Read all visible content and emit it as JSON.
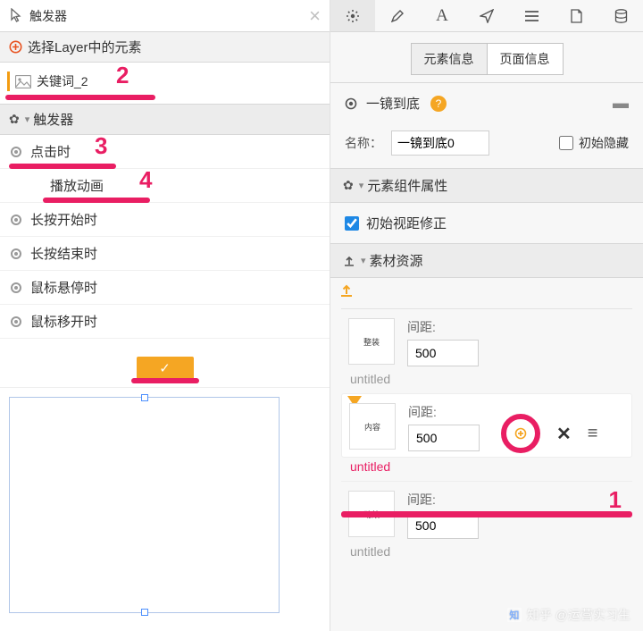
{
  "left": {
    "title": "触发器",
    "select_label": "选择Layer中的元素",
    "keyword_label": "关键词_2",
    "trigger_header": "触发器",
    "triggers": [
      {
        "label": "点击时"
      },
      {
        "label": "播放动画",
        "sub": true
      },
      {
        "label": "长按开始时"
      },
      {
        "label": "长按结束时"
      },
      {
        "label": "鼠标悬停时"
      },
      {
        "label": "鼠标移开时"
      }
    ],
    "confirm": "✓"
  },
  "right": {
    "tabs": {
      "element": "元素信息",
      "page": "页面信息"
    },
    "section_title": "一镜到底",
    "name_label": "名称：",
    "name_value": "一镜到底0",
    "hidden_label": "初始隐藏",
    "comp_header": "元素组件属性",
    "viewfix_label": "初始视距修正",
    "assets_header": "素材资源",
    "assets": [
      {
        "thumb": "整装",
        "dist_label": "间距:",
        "dist_value": "500",
        "title": "untitled"
      },
      {
        "thumb": "内容",
        "dist_label": "间距:",
        "dist_value": "500",
        "title": "untitled"
      },
      {
        "thumb": "动效",
        "dist_label": "间距:",
        "dist_value": "500",
        "title": "untitled"
      }
    ]
  },
  "annotations": {
    "n1": "1",
    "n2": "2",
    "n3": "3",
    "n4": "4"
  },
  "watermark": "知乎 @运营实习生"
}
